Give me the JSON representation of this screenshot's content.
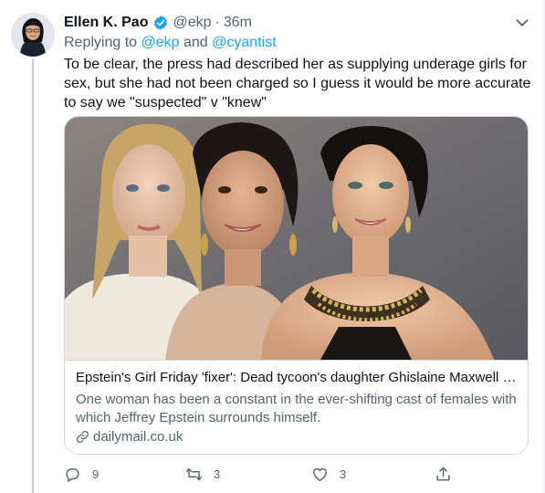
{
  "tweet": {
    "author_name": "Ellen K. Pao",
    "handle": "@ekp",
    "separator": "·",
    "time": "36m",
    "replying_prefix": "Replying to",
    "reply_mentions": [
      "@ekp",
      "@cyantist"
    ],
    "replying_and": "and",
    "text": "To be clear, the press had described her as supplying underage girls for sex, but she had not been charged so I guess it would be more accurate to say we \"suspected\" v \"knew\""
  },
  "card": {
    "title": "Epstein's Girl Friday 'fixer': Dead tycoon's daughter Ghislaine Maxwell an...",
    "description": "One woman has been a constant in the ever-shifting cast of females with which Jeffrey Epstein surrounds himself.",
    "domain": "dailymail.co.uk"
  },
  "actions": {
    "reply_count": "9",
    "retweet_count": "3",
    "like_count": "3"
  },
  "colors": {
    "accent": "#1da1f2",
    "text_primary": "#0f1419",
    "text_secondary": "#536471",
    "border": "#cfd9de",
    "thread_line": "#c4cfd6"
  },
  "icons": [
    "verified-badge-icon",
    "chevron-down-icon",
    "link-icon",
    "reply-icon",
    "retweet-icon",
    "like-icon",
    "share-icon"
  ]
}
